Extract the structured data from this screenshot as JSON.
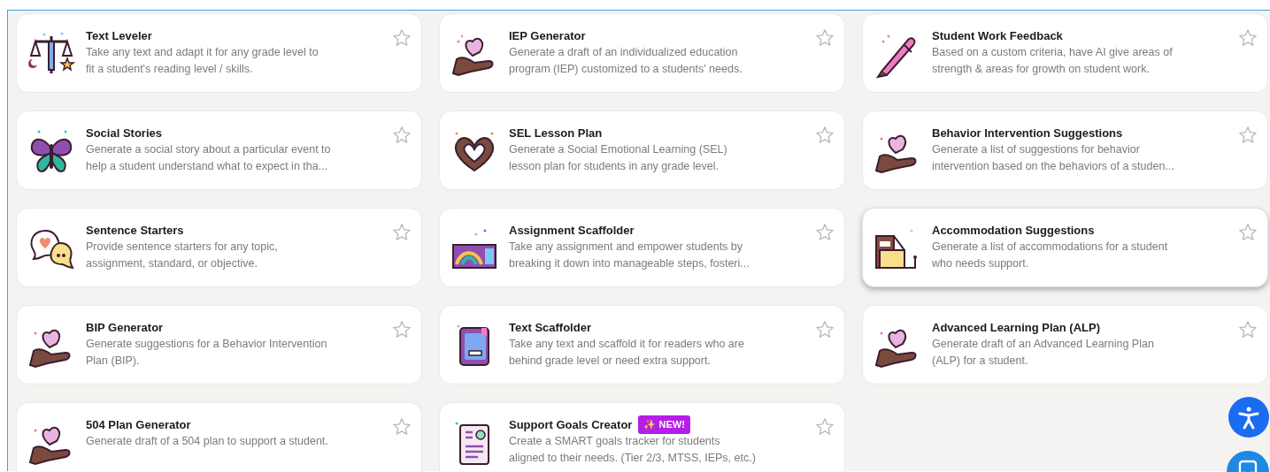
{
  "tools": [
    {
      "title": "Text Leveler",
      "description_lines": [
        "Take any text and adapt it for any grade level to",
        "fit a student's reading level / skills."
      ],
      "favorite": false,
      "hovered": false
    },
    {
      "title": "IEP Generator",
      "description_lines": [
        "Generate a draft of an individualized education",
        "program (IEP) customized to a students' needs."
      ],
      "favorite": false,
      "hovered": false
    },
    {
      "title": "Student Work Feedback",
      "description_lines": [
        "Based on a custom criteria, have AI give areas of",
        "strength & areas for growth on student work."
      ],
      "favorite": false,
      "hovered": false
    },
    {
      "title": "Social Stories",
      "description_lines": [
        "Generate a social story about a particular event to",
        "help a student understand what to expect in tha..."
      ],
      "favorite": false,
      "hovered": false
    },
    {
      "title": "SEL Lesson Plan",
      "description_lines": [
        "Generate a Social Emotional Learning (SEL)",
        "lesson plan for students in any grade level."
      ],
      "favorite": false,
      "hovered": false
    },
    {
      "title": "Behavior Intervention Suggestions",
      "description_lines": [
        "Generate a list of suggestions for behavior",
        "intervention based on the behaviors of a studen..."
      ],
      "favorite": false,
      "hovered": false
    },
    {
      "title": "Sentence Starters",
      "description_lines": [
        "Provide sentence starters for any topic,",
        "assignment, standard, or objective."
      ],
      "favorite": false,
      "hovered": false
    },
    {
      "title": "Assignment Scaffolder",
      "description_lines": [
        "Take any assignment and empower students by",
        "breaking it down into manageable steps, fosteri..."
      ],
      "favorite": false,
      "hovered": false
    },
    {
      "title": "Accommodation Suggestions",
      "description_lines": [
        "Generate a list of accommodations for a student",
        "who needs support."
      ],
      "favorite": false,
      "hovered": true
    },
    {
      "title": "BIP Generator",
      "description_lines": [
        "Generate suggestions for a Behavior Intervention",
        "Plan (BIP)."
      ],
      "favorite": false,
      "hovered": false
    },
    {
      "title": "Text Scaffolder",
      "description_lines": [
        "Take any text and scaffold it for readers who are",
        "behind grade level or need extra support."
      ],
      "favorite": false,
      "hovered": false
    },
    {
      "title": "Advanced Learning Plan (ALP)",
      "description_lines": [
        "Generate draft of an Advanced Learning Plan",
        "(ALP) for a student."
      ],
      "favorite": false,
      "hovered": false
    },
    {
      "title": "504 Plan Generator",
      "description_lines": [
        "Generate draft of a 504 plan to support a student."
      ],
      "favorite": false,
      "hovered": false
    },
    {
      "title": "Support Goals Creator",
      "badge": "✨ NEW!",
      "description_lines": [
        "Create a SMART goals tracker for students",
        "aligned to their needs. (Tier 2/3, MTSS, IEPs, etc.)"
      ],
      "favorite": false,
      "hovered": false
    }
  ]
}
